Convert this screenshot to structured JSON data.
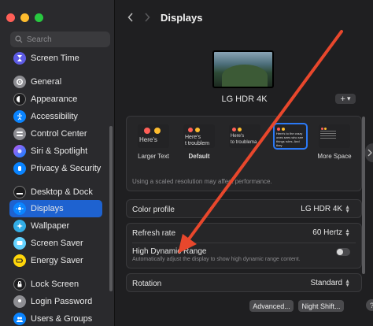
{
  "window": {
    "title": "Displays"
  },
  "sidebar": {
    "search": {
      "placeholder": "Search"
    },
    "items": [
      {
        "label": "Screen Time",
        "icon": "hourglass-icon",
        "color": "#5e5ce6"
      },
      {
        "label": "General",
        "icon": "gear-icon",
        "color": "#8e8e93"
      },
      {
        "label": "Appearance",
        "icon": "appearance-icon",
        "color": "#1c1c1e"
      },
      {
        "label": "Accessibility",
        "icon": "accessibility-icon",
        "color": "#0a84ff"
      },
      {
        "label": "Control Center",
        "icon": "control-center-icon",
        "color": "#8e8e93"
      },
      {
        "label": "Siri & Spotlight",
        "icon": "siri-icon",
        "color": "#bf5af2"
      },
      {
        "label": "Privacy & Security",
        "icon": "hand-icon",
        "color": "#0a84ff"
      },
      {
        "label": "Desktop & Dock",
        "icon": "dock-icon",
        "color": "#1c1c1e"
      },
      {
        "label": "Displays",
        "icon": "sun-icon",
        "color": "#0a84ff",
        "active": true
      },
      {
        "label": "Wallpaper",
        "icon": "wallpaper-icon",
        "color": "#32ade6"
      },
      {
        "label": "Screen Saver",
        "icon": "screen-saver-icon",
        "color": "#64d2ff"
      },
      {
        "label": "Energy Saver",
        "icon": "battery-icon",
        "color": "#ffd60a"
      },
      {
        "label": "Lock Screen",
        "icon": "lock-icon",
        "color": "#1c1c1e"
      },
      {
        "label": "Login Password",
        "icon": "login-icon",
        "color": "#8e8e93"
      },
      {
        "label": "Users & Groups",
        "icon": "users-icon",
        "color": "#0a84ff"
      }
    ]
  },
  "main": {
    "monitor_name": "LG HDR 4K",
    "add_button": {
      "label": "+",
      "icon": "chevron-down-icon"
    },
    "resolution": {
      "options": [
        {
          "label": "Larger Text",
          "preview": "Here's",
          "selected": false
        },
        {
          "label": "Default",
          "preview": "Here's t troublem",
          "selected": false,
          "bold": true
        },
        {
          "label": "",
          "preview": "Here's to troublema",
          "selected": false
        },
        {
          "label": "",
          "preview": "Here's to the crazy ones sees who see things rules. And they",
          "selected": true
        },
        {
          "label": "More Space",
          "preview": "",
          "selected": false
        }
      ],
      "hint": "Using a scaled resolution may affect performance."
    },
    "color_profile": {
      "label": "Color profile",
      "value": "LG HDR 4K"
    },
    "refresh_rate": {
      "label": "Refresh rate",
      "value": "60 Hertz"
    },
    "hdr": {
      "label": "High Dynamic Range",
      "description": "Automatically adjust the display to show high dynamic range content.",
      "enabled": false
    },
    "rotation": {
      "label": "Rotation",
      "value": "Standard"
    },
    "buttons": {
      "advanced": "Advanced...",
      "night_shift": "Night Shift...",
      "help": "?"
    }
  },
  "annotation": {
    "color": "#e8472c"
  }
}
